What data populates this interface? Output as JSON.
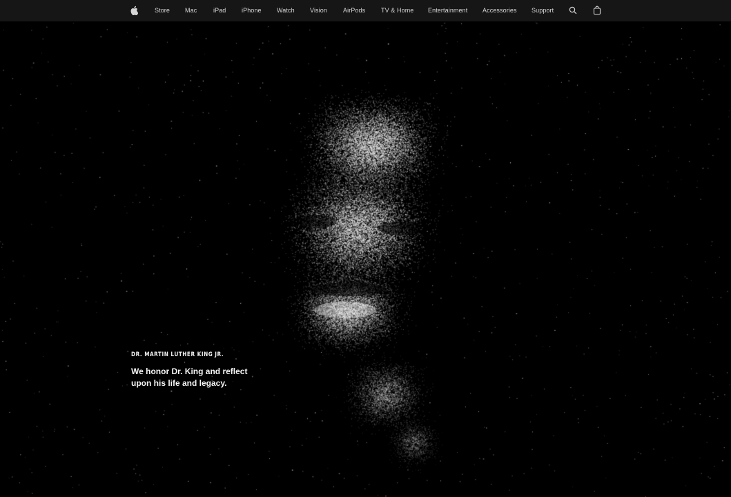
{
  "globalnav": {
    "logo_icon": "apple-logo-icon",
    "items": [
      {
        "label": "Store"
      },
      {
        "label": "Mac"
      },
      {
        "label": "iPad"
      },
      {
        "label": "iPhone"
      },
      {
        "label": "Watch"
      },
      {
        "label": "Vision"
      },
      {
        "label": "AirPods"
      },
      {
        "label": "TV & Home"
      },
      {
        "label": "Entertainment"
      },
      {
        "label": "Accessories"
      },
      {
        "label": "Support"
      }
    ],
    "search_icon": "search-icon",
    "bag_icon": "shopping-bag-icon"
  },
  "hero": {
    "eyebrow": "DR. MARTIN LUTHER KING JR.",
    "headline": "We honor Dr. King and reflect upon his life and legacy.",
    "portrait": "particle-portrait-image",
    "colors": {
      "background": "#000000",
      "nav_background": "#161617",
      "text": "#f5f5f7"
    }
  }
}
